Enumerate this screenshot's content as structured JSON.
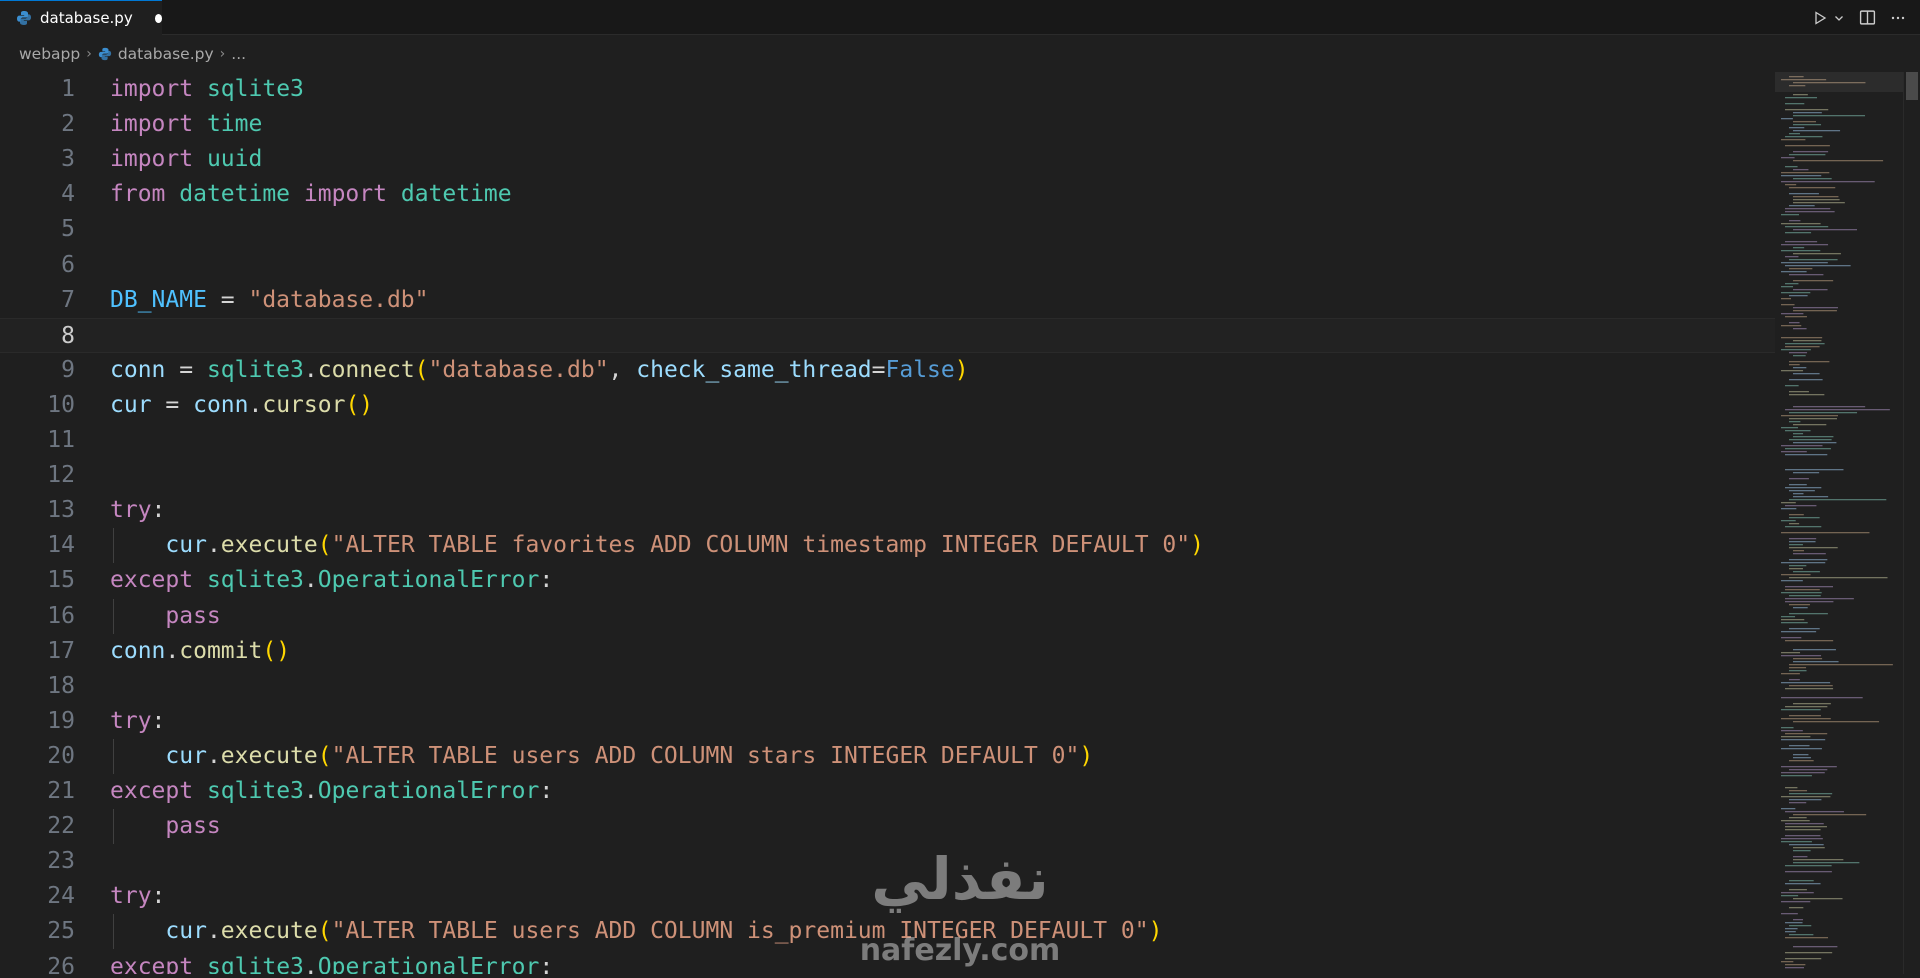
{
  "tab": {
    "filename": "database.py"
  },
  "breadcrumb": {
    "folder": "webapp",
    "file": "database.py",
    "ellipsis": "..."
  },
  "editor": {
    "active_line": 8,
    "lines": [
      {
        "n": "1",
        "t": [
          [
            "kw",
            "import"
          ],
          [
            "pl",
            " "
          ],
          [
            "mod",
            "sqlite3"
          ]
        ]
      },
      {
        "n": "2",
        "t": [
          [
            "kw",
            "import"
          ],
          [
            "pl",
            " "
          ],
          [
            "mod",
            "time"
          ]
        ]
      },
      {
        "n": "3",
        "t": [
          [
            "kw",
            "import"
          ],
          [
            "pl",
            " "
          ],
          [
            "mod",
            "uuid"
          ]
        ]
      },
      {
        "n": "4",
        "t": [
          [
            "kw",
            "from"
          ],
          [
            "pl",
            " "
          ],
          [
            "mod",
            "datetime"
          ],
          [
            "pl",
            " "
          ],
          [
            "kw",
            "import"
          ],
          [
            "pl",
            " "
          ],
          [
            "mod",
            "datetime"
          ]
        ]
      },
      {
        "n": "5",
        "t": []
      },
      {
        "n": "6",
        "t": []
      },
      {
        "n": "7",
        "t": [
          [
            "var",
            "DB_NAME"
          ],
          [
            "op",
            " = "
          ],
          [
            "str",
            "\"database.db\""
          ]
        ]
      },
      {
        "n": "8",
        "t": []
      },
      {
        "n": "9",
        "t": [
          [
            "vr",
            "conn"
          ],
          [
            "op",
            " = "
          ],
          [
            "mod",
            "sqlite3"
          ],
          [
            "pl",
            "."
          ],
          [
            "fn",
            "connect"
          ],
          [
            "pn",
            "("
          ],
          [
            "str",
            "\"database.db\""
          ],
          [
            "pl",
            ", "
          ],
          [
            "vr",
            "check_same_thread"
          ],
          [
            "op",
            "="
          ],
          [
            "bool",
            "False"
          ],
          [
            "pn",
            ")"
          ]
        ]
      },
      {
        "n": "10",
        "t": [
          [
            "vr",
            "cur"
          ],
          [
            "op",
            " = "
          ],
          [
            "vr",
            "conn"
          ],
          [
            "pl",
            "."
          ],
          [
            "fn",
            "cursor"
          ],
          [
            "pn",
            "()"
          ]
        ]
      },
      {
        "n": "11",
        "t": []
      },
      {
        "n": "12",
        "t": []
      },
      {
        "n": "13",
        "t": [
          [
            "kw",
            "try"
          ],
          [
            "pl",
            ":"
          ]
        ]
      },
      {
        "n": "14",
        "indent": true,
        "t": [
          [
            "pl",
            "    "
          ],
          [
            "vr",
            "cur"
          ],
          [
            "pl",
            "."
          ],
          [
            "fn",
            "execute"
          ],
          [
            "pn",
            "("
          ],
          [
            "str",
            "\"ALTER TABLE favorites ADD COLUMN timestamp INTEGER DEFAULT 0\""
          ],
          [
            "pn",
            ")"
          ]
        ]
      },
      {
        "n": "15",
        "t": [
          [
            "kw",
            "except"
          ],
          [
            "pl",
            " "
          ],
          [
            "mod",
            "sqlite3"
          ],
          [
            "pl",
            "."
          ],
          [
            "mod",
            "OperationalError"
          ],
          [
            "pl",
            ":"
          ]
        ]
      },
      {
        "n": "16",
        "indent": true,
        "t": [
          [
            "pl",
            "    "
          ],
          [
            "kw",
            "pass"
          ]
        ]
      },
      {
        "n": "17",
        "t": [
          [
            "vr",
            "conn"
          ],
          [
            "pl",
            "."
          ],
          [
            "fn",
            "commit"
          ],
          [
            "pn",
            "()"
          ]
        ]
      },
      {
        "n": "18",
        "t": []
      },
      {
        "n": "19",
        "t": [
          [
            "kw",
            "try"
          ],
          [
            "pl",
            ":"
          ]
        ]
      },
      {
        "n": "20",
        "indent": true,
        "t": [
          [
            "pl",
            "    "
          ],
          [
            "vr",
            "cur"
          ],
          [
            "pl",
            "."
          ],
          [
            "fn",
            "execute"
          ],
          [
            "pn",
            "("
          ],
          [
            "str",
            "\"ALTER TABLE users ADD COLUMN stars INTEGER DEFAULT 0\""
          ],
          [
            "pn",
            ")"
          ]
        ]
      },
      {
        "n": "21",
        "t": [
          [
            "kw",
            "except"
          ],
          [
            "pl",
            " "
          ],
          [
            "mod",
            "sqlite3"
          ],
          [
            "pl",
            "."
          ],
          [
            "mod",
            "OperationalError"
          ],
          [
            "pl",
            ":"
          ]
        ]
      },
      {
        "n": "22",
        "indent": true,
        "t": [
          [
            "pl",
            "    "
          ],
          [
            "kw",
            "pass"
          ]
        ]
      },
      {
        "n": "23",
        "t": []
      },
      {
        "n": "24",
        "t": [
          [
            "kw",
            "try"
          ],
          [
            "pl",
            ":"
          ]
        ]
      },
      {
        "n": "25",
        "indent": true,
        "t": [
          [
            "pl",
            "    "
          ],
          [
            "vr",
            "cur"
          ],
          [
            "pl",
            "."
          ],
          [
            "fn",
            "execute"
          ],
          [
            "pn",
            "("
          ],
          [
            "str",
            "\"ALTER TABLE users ADD COLUMN is_premium INTEGER DEFAULT 0\""
          ],
          [
            "pn",
            ")"
          ]
        ]
      },
      {
        "n": "26",
        "t": [
          [
            "kw",
            "except"
          ],
          [
            "pl",
            " "
          ],
          [
            "mod",
            "sqlite3"
          ],
          [
            "pl",
            "."
          ],
          [
            "mod",
            "OperationalError"
          ],
          [
            "pl",
            ":"
          ]
        ]
      }
    ]
  },
  "watermark": {
    "arabic": "نفذلي",
    "latin": "nafezly.com"
  },
  "colors": {
    "accent": "#0078d4",
    "background": "#1f1f1f"
  },
  "icons": [
    "python-file-icon",
    "run-icon",
    "chevron-down-icon",
    "split-editor-icon",
    "more-actions-icon",
    "chevron-right-icon"
  ]
}
